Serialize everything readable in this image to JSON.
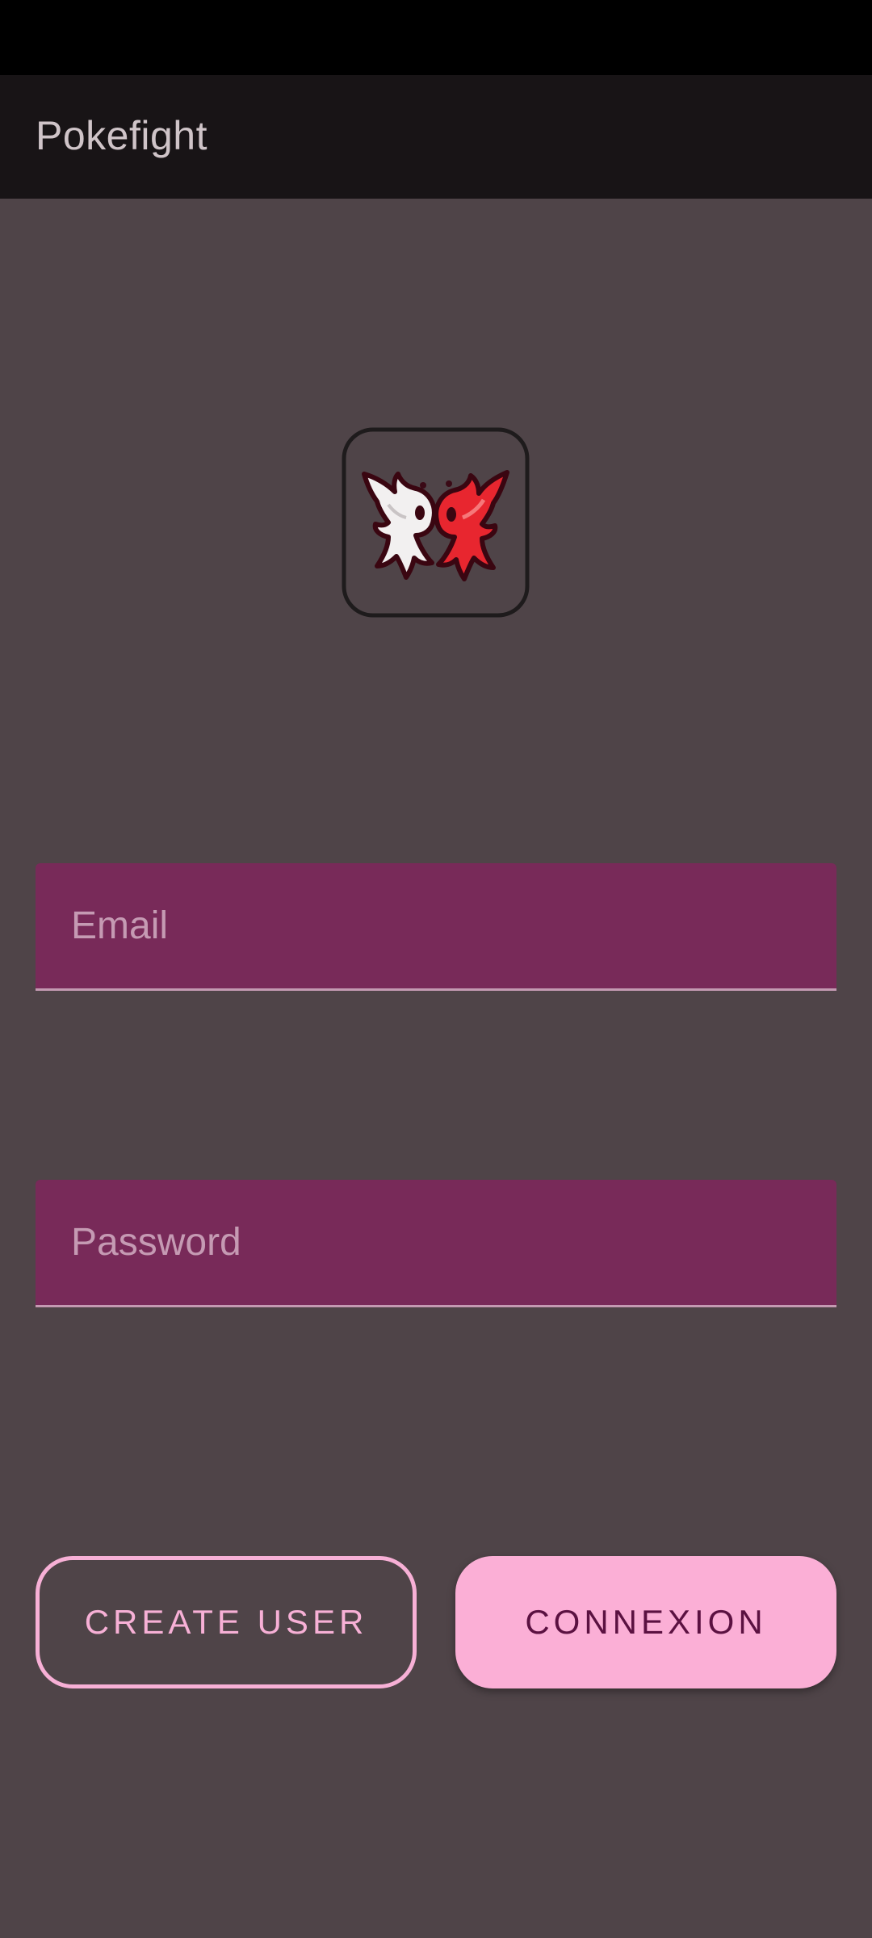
{
  "app_bar": {
    "title": "Pokefight"
  },
  "logo": {
    "icon": "two-fighting-creatures-icon"
  },
  "form": {
    "email": {
      "value": "",
      "placeholder": "Email"
    },
    "password": {
      "value": "",
      "placeholder": "Password"
    }
  },
  "buttons": {
    "create_user": "CREATE USER",
    "connexion": "CONNEXION"
  },
  "colors": {
    "background": "#4f4448",
    "app_bar": "#181416",
    "field_fill": "#782a59",
    "accent": "#fbafd6",
    "accent_text": "#5b1141"
  }
}
